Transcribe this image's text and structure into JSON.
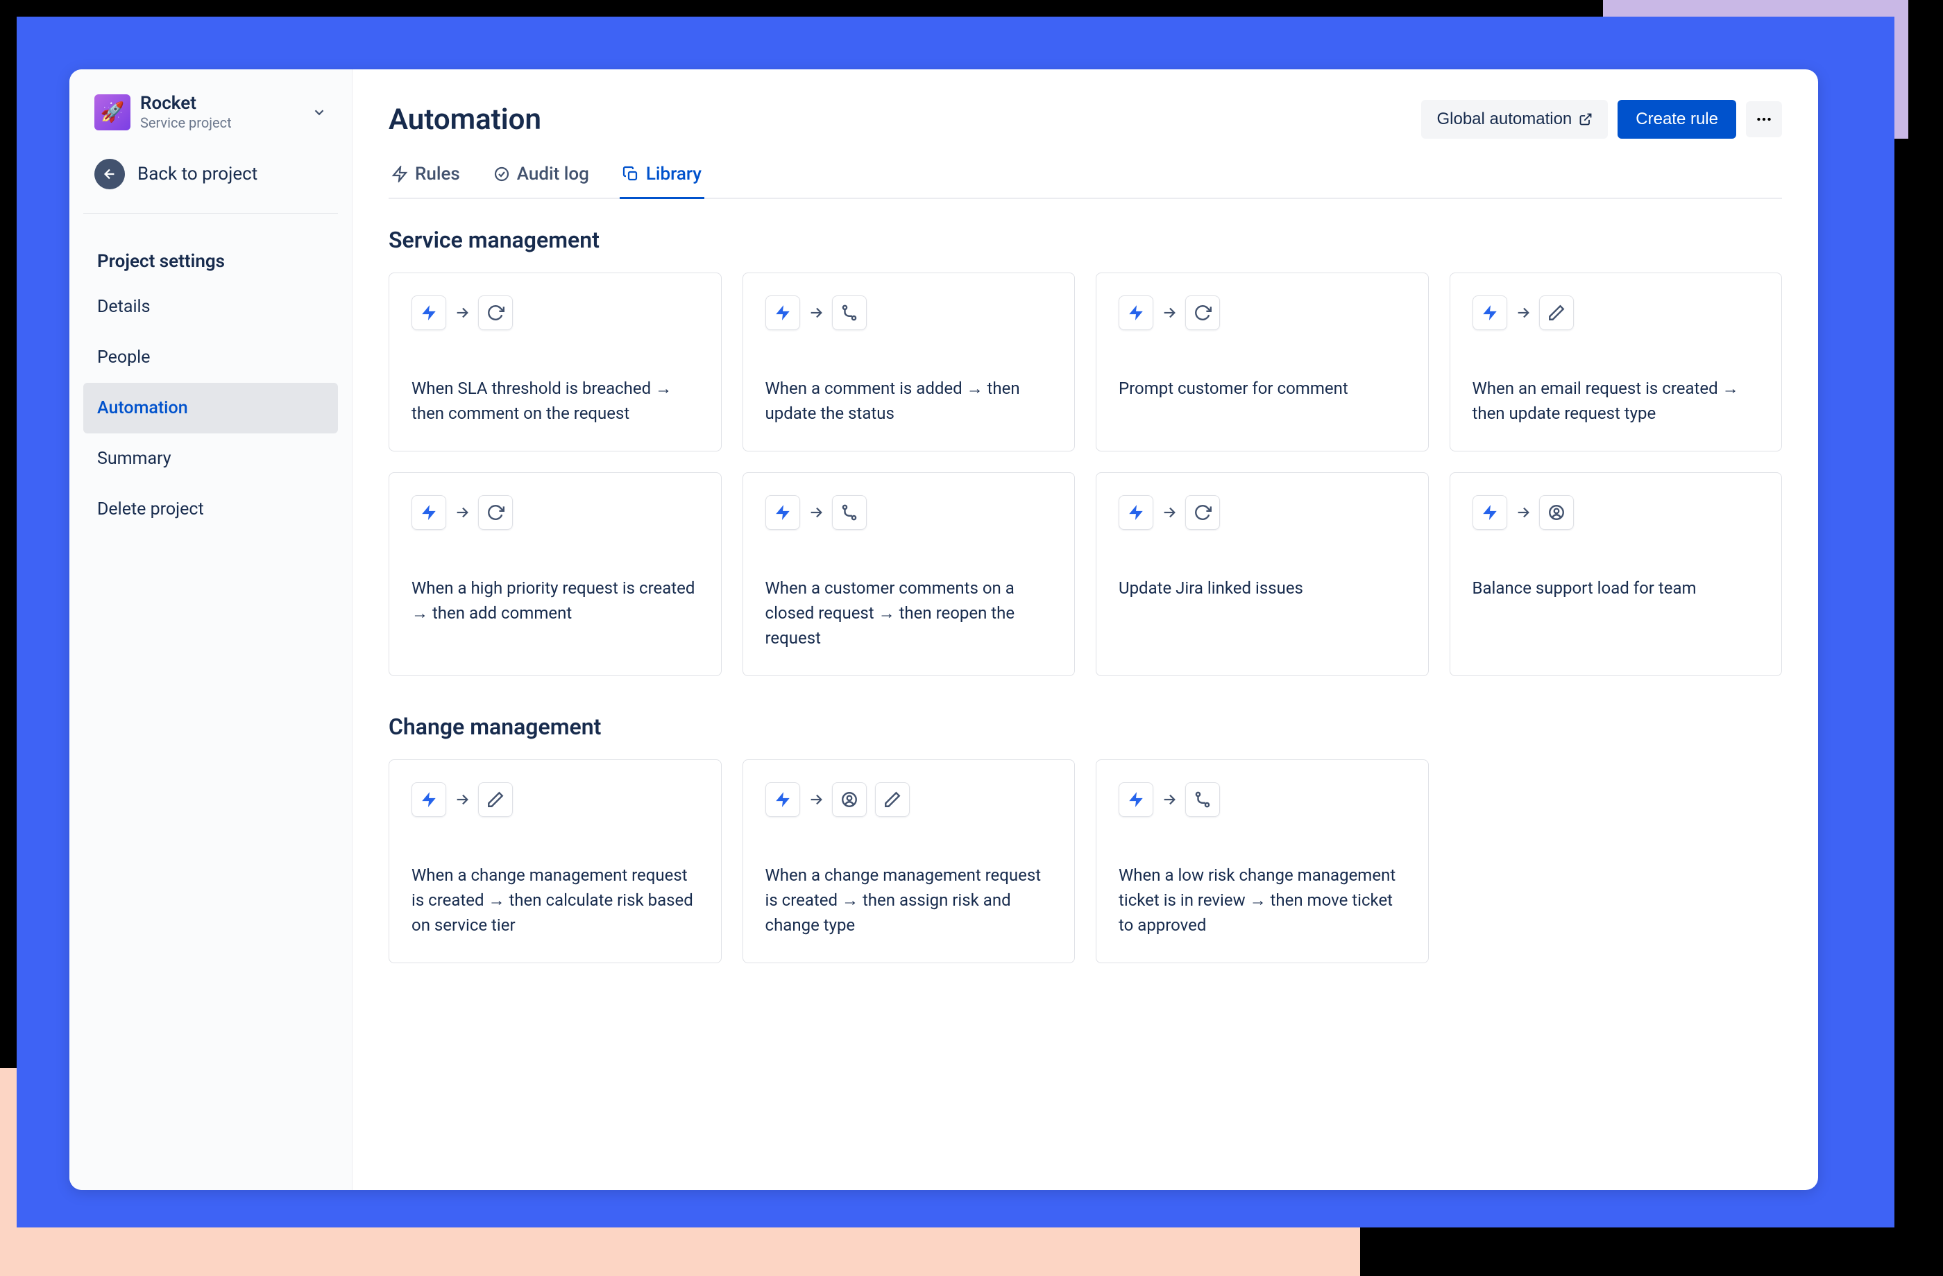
{
  "sidebar": {
    "project_name": "Rocket",
    "project_subtitle": "Service project",
    "back_label": "Back to project",
    "settings_heading": "Project settings",
    "nav": [
      {
        "label": "Details",
        "active": false
      },
      {
        "label": "People",
        "active": false
      },
      {
        "label": "Automation",
        "active": true
      },
      {
        "label": "Summary",
        "active": false
      },
      {
        "label": "Delete project",
        "active": false
      }
    ]
  },
  "header": {
    "title": "Automation",
    "global_label": "Global automation",
    "create_label": "Create rule"
  },
  "tabs": [
    {
      "label": "Rules",
      "icon": "bolt",
      "active": false
    },
    {
      "label": "Audit log",
      "icon": "check-circle",
      "active": false
    },
    {
      "label": "Library",
      "icon": "copy",
      "active": true
    }
  ],
  "sections": [
    {
      "title": "Service management",
      "cards": [
        {
          "actions": [
            "refresh"
          ],
          "desc": "When SLA threshold is breached → then comment on the request"
        },
        {
          "actions": [
            "branch"
          ],
          "desc": "When a comment is added → then update the status"
        },
        {
          "actions": [
            "refresh"
          ],
          "desc": "Prompt customer for comment"
        },
        {
          "actions": [
            "pencil"
          ],
          "desc": "When an email request is created → then update request type"
        },
        {
          "actions": [
            "refresh"
          ],
          "desc": "When a high priority request is created → then add comment"
        },
        {
          "actions": [
            "branch"
          ],
          "desc": "When a customer comments on a closed request → then reopen the request"
        },
        {
          "actions": [
            "refresh"
          ],
          "desc": "Update Jira linked issues"
        },
        {
          "actions": [
            "user"
          ],
          "desc": "Balance support load for team"
        }
      ]
    },
    {
      "title": "Change management",
      "cards": [
        {
          "actions": [
            "pencil"
          ],
          "desc": "When a change management request is created → then calculate risk based on service tier"
        },
        {
          "actions": [
            "user",
            "pencil"
          ],
          "desc": "When a change management request is created → then assign risk and change type"
        },
        {
          "actions": [
            "branch"
          ],
          "desc": "When a low risk change management ticket is in review → then move ticket to approved"
        }
      ]
    }
  ]
}
